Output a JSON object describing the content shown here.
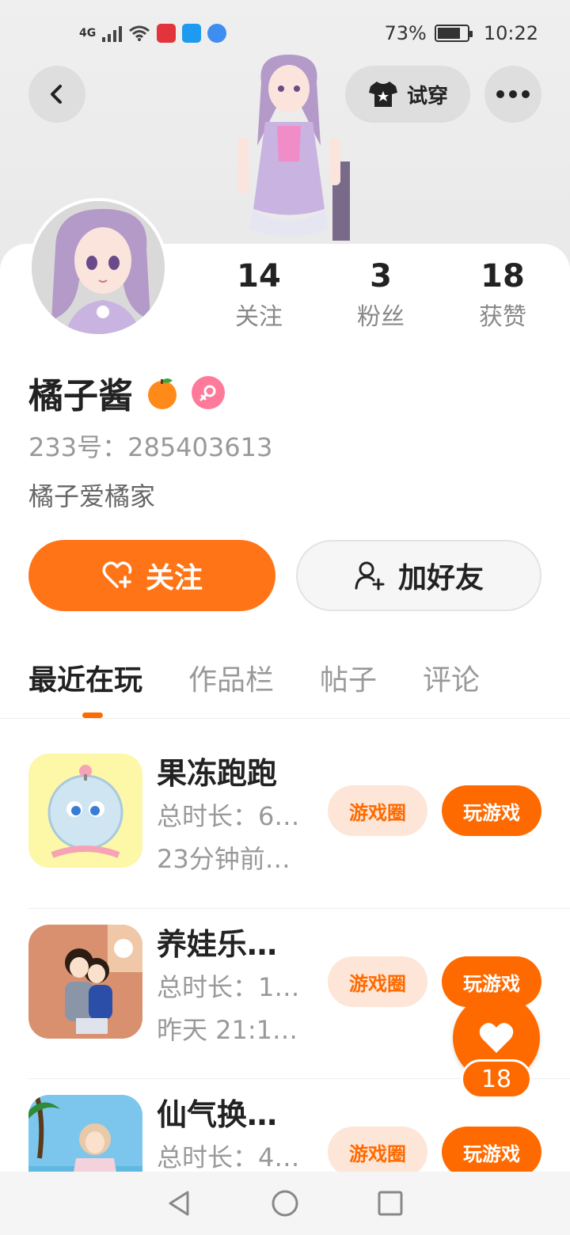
{
  "status_bar": {
    "network": "4G",
    "battery": "73%",
    "time": "10:22"
  },
  "header": {
    "tryon_label": "试穿"
  },
  "profile": {
    "stats": [
      {
        "value": "14",
        "label": "关注"
      },
      {
        "value": "3",
        "label": "粉丝"
      },
      {
        "value": "18",
        "label": "获赞"
      }
    ],
    "name": "橘子酱",
    "uid_label": "233号：",
    "uid": "285403613",
    "bio": "橘子爱橘家"
  },
  "actions": {
    "follow_label": "关注",
    "add_friend_label": "加好友"
  },
  "tabs": [
    {
      "label": "最近在玩"
    },
    {
      "label": "作品栏"
    },
    {
      "label": "帖子"
    },
    {
      "label": "评论"
    }
  ],
  "games": [
    {
      "title": "果冻跑跑",
      "duration": "总时长：6…",
      "last_played": "23分钟前…",
      "circle_label": "游戏圈",
      "play_label": "玩游戏"
    },
    {
      "title": "养娃乐…",
      "duration": "总时长：1…",
      "last_played": "昨天 21:1…",
      "circle_label": "游戏圈",
      "play_label": "玩游戏"
    },
    {
      "title": "仙气换…",
      "duration": "总时长：4…",
      "last_played": "",
      "circle_label": "游戏圈",
      "play_label": "玩游戏"
    }
  ],
  "like_fab": {
    "count": "18"
  },
  "colors": {
    "accent": "#ff6a00",
    "accent_light": "#fde6d8",
    "gender_female": "#ff7a9a"
  }
}
